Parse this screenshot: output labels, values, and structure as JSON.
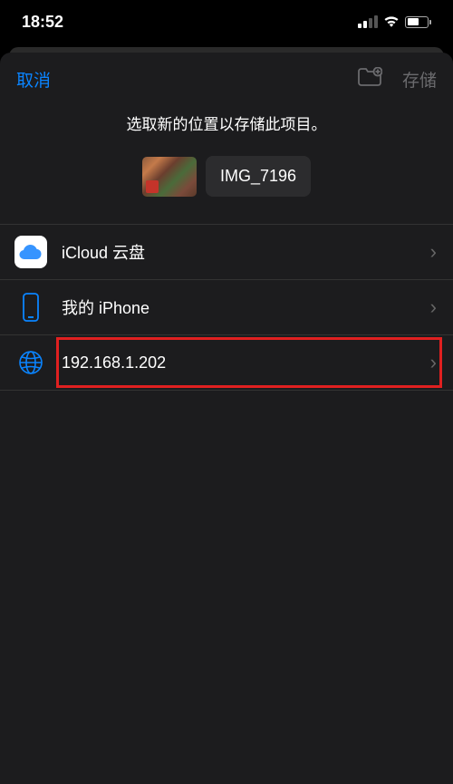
{
  "statusBar": {
    "time": "18:52"
  },
  "modal": {
    "cancelLabel": "取消",
    "saveLabel": "存储",
    "instruction": "选取新的位置以存储此项目。",
    "filename": "IMG_7196"
  },
  "locations": [
    {
      "label": "iCloud 云盘"
    },
    {
      "label": "我的 iPhone"
    },
    {
      "label": "192.168.1.202"
    }
  ]
}
